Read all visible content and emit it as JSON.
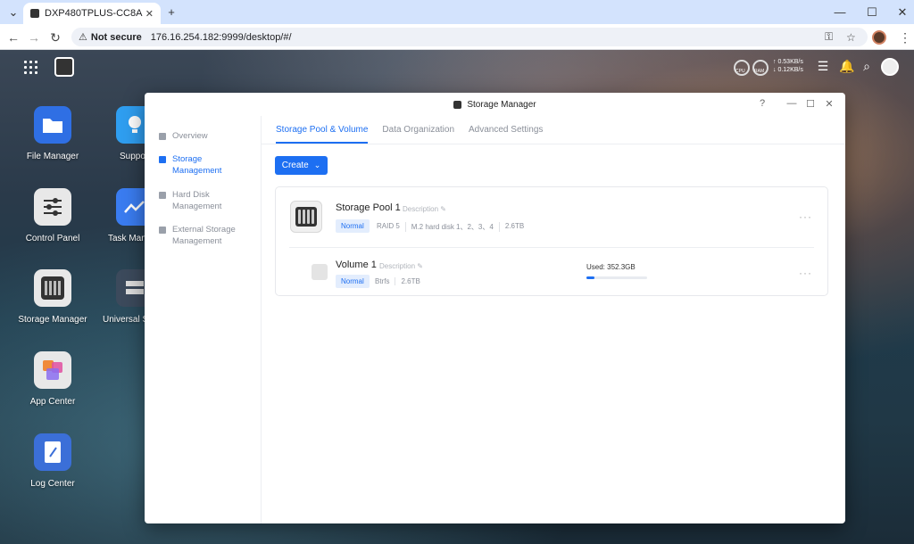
{
  "browser": {
    "tab_title": "DXP480TPLUS-CC8A",
    "not_secure": "Not secure",
    "url": "176.16.254.182:9999/desktop/#/"
  },
  "topbar": {
    "cpu_label": "CPU",
    "ram_label": "RAM",
    "upload_speed": "↑ 0.53KB/s",
    "download_speed": "↓ 0.12KB/s"
  },
  "desktop_icons": [
    {
      "label": "File Manager",
      "color": "#2f6fe4"
    },
    {
      "label": "Support",
      "color": "#2f9ef0"
    },
    {
      "label": "Control Panel",
      "color": "#e8e8e8"
    },
    {
      "label": "Task Manager",
      "color": "#3a7cf0"
    },
    {
      "label": "Storage Manager",
      "color": "#e8e8e8"
    },
    {
      "label": "Universal Search",
      "color": "#3c4a5c"
    },
    {
      "label": "App Center",
      "color": "#e8e8e8"
    },
    {
      "label": "Log Center",
      "color": "#3b6fd8"
    }
  ],
  "window": {
    "title": "Storage Manager",
    "sidebar": [
      {
        "label1": "Overview",
        "label2": ""
      },
      {
        "label1": "Storage",
        "label2": "Management"
      },
      {
        "label1": "Hard Disk",
        "label2": "Management"
      },
      {
        "label1": "External Storage",
        "label2": "Management"
      }
    ],
    "tabs": [
      "Storage Pool & Volume",
      "Data Organization",
      "Advanced Settings"
    ],
    "create_label": "Create",
    "pool": {
      "name": "Storage Pool 1",
      "description": "Description",
      "status": "Normal",
      "raid": "RAID 5",
      "disks": "M.2 hard disk 1、2、3、4",
      "capacity": "2.6TB"
    },
    "volume": {
      "name": "Volume 1",
      "description": "Description",
      "status": "Normal",
      "fs": "Btrfs",
      "capacity": "2.6TB",
      "used_label": "Used: 352.3GB",
      "used_fraction": 0.13
    }
  },
  "colors": {
    "accent": "#1d6ff2"
  }
}
